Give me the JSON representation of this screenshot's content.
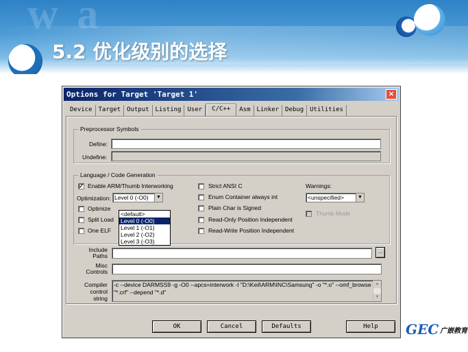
{
  "slide": {
    "title": "5.2 优化级别的选择",
    "brand_mark": "GEC",
    "brand_name": "广嵌教育"
  },
  "dialog": {
    "title": "Options for Target 'Target 1'",
    "close_glyph": "×",
    "tabs": [
      "Device",
      "Target",
      "Output",
      "Listing",
      "User",
      "C/C++",
      "Asm",
      "Linker",
      "Debug",
      "Utilities"
    ],
    "active_tab": "C/C++",
    "preprocessor": {
      "legend": "Preprocessor Symbols",
      "define_label": "Define:",
      "define_value": "",
      "undefine_label": "Undefine:",
      "undefine_value": ""
    },
    "language": {
      "legend": "Language / Code Generation",
      "interworking_label": "Enable ARM/Thumb Interworking",
      "interworking_checked": "✓",
      "optimization_label": "Optimization:",
      "optimization_value": "Level 0 (-O0)",
      "optimize_label": "Optimize",
      "split_label": "Split Load",
      "one_elf_label": "One ELF",
      "dropdown_options": [
        "<default>",
        "Level 0 (-O0)",
        "Level 1 (-O1)",
        "Level 2 (-O2)",
        "Level 3 (-O3)"
      ],
      "dropdown_selected_index": 1,
      "strict_label": "Strict ANSI C",
      "enum_label": "Enum Container always int",
      "plain_char_label": "Plain Char is Signed",
      "ro_label": "Read-Only Position Independent",
      "rw_label": "Read-Write Position Independent",
      "warnings_label": "Warnings:",
      "warnings_value": "<unspecified>",
      "thumb_mode_label": "Thumb Mode"
    },
    "include_paths_label": "Include Paths",
    "include_paths_value": "",
    "browse_glyph": "...",
    "misc_label": "Misc Controls",
    "misc_value": "",
    "compiler_label": "Compiler control string",
    "compiler_string": "-c --device DARMSS9 -g -O0 --apcs=interwork -I \"D:\\Keil\\ARM\\INC\\Samsung\" -o \"*.o\" --omf_browse \"*.crf\" --depend \"*.d\"",
    "buttons": {
      "ok": "OK",
      "cancel": "Cancel",
      "defaults": "Defaults",
      "help": "Help"
    }
  }
}
